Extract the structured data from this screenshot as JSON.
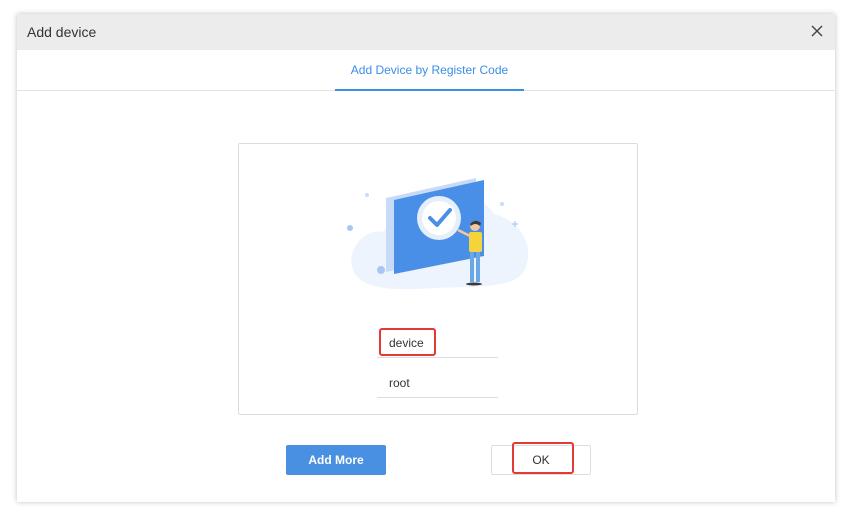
{
  "dialog": {
    "title": "Add device",
    "close_icon": "close-icon"
  },
  "tabs": [
    {
      "label": "Add Device by Register Code",
      "active": true
    }
  ],
  "form": {
    "username_value": "device",
    "password_value": "root"
  },
  "buttons": {
    "add_more": "Add More",
    "ok": "OK"
  },
  "colors": {
    "accent": "#3a8ee6",
    "primary_button": "#4a90e2",
    "highlight": "#e53935"
  }
}
